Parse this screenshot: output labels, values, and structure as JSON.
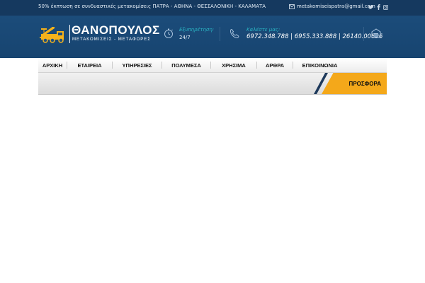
{
  "topbar": {
    "promo_text": "50% έκπτωση σε συνδυαστικές μετακομίσεις ΠΑΤΡΑ - ΑΘΗΝΑ - ΘΕΣΣΑΛΟΝΙΚΗ - ΚΑΛΑΜΑΤΑ",
    "email": "metakomiseispatra@gmail.com",
    "social": [
      "twitter-icon",
      "facebook-icon",
      "instagram-icon"
    ]
  },
  "logo": {
    "title": "ΘΑΝΟΠΟΥΛΟΣ",
    "subtitle": "ΜΕΤΑΚΟΜΙΣΕΙΣ - ΜΕΤΑΦΟΡΕΣ"
  },
  "info": {
    "service_label": "Εξυπηρέτηση:",
    "service_value": "24/7",
    "call_label": "Καλέστε μας:",
    "call_value": "6972.348.788 | 6955.333.888 | 26140.00896"
  },
  "nav": {
    "items": [
      {
        "label": "ΑΡΧΙΚΗ"
      },
      {
        "label": "ΕΤΑΙΡΕΙΑ"
      },
      {
        "label": "ΥΠΗΡΕΣΙΕΣ"
      },
      {
        "label": "ΠΟΛΥΜΕΣΑ"
      },
      {
        "label": "ΧΡΗΣΙΜΑ"
      },
      {
        "label": "ΑΡΘΡΑ"
      },
      {
        "label": "ΕΠΙΚΟΙΝΩΝΙΑ"
      }
    ]
  },
  "offer": {
    "label": "ΠΡΟΣΦΟΡΑ"
  },
  "colors": {
    "header_bg": "#1d4f7e",
    "accent_cyan": "#2ab3c2",
    "offer_orange": "#f4a81a",
    "logo_yellow": "#f6b21b"
  }
}
